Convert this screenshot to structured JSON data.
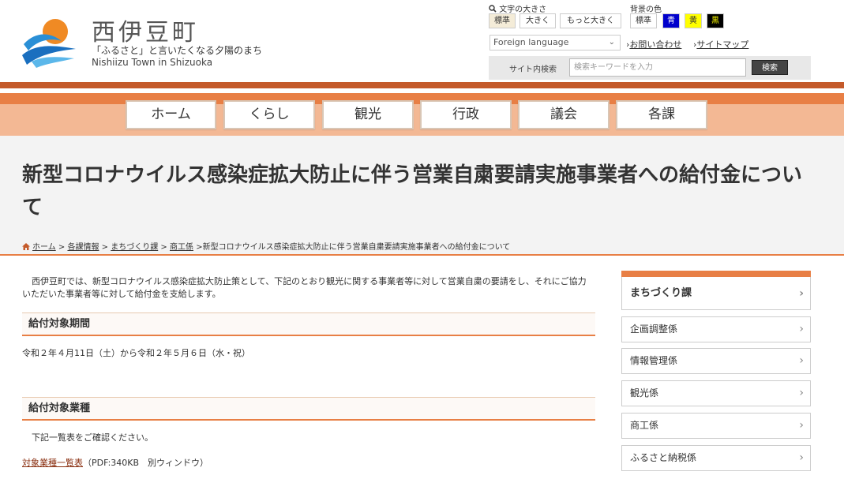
{
  "header": {
    "site_name": "西伊豆町",
    "tagline": "「ふるさと」と言いたくなる夕陽のまち",
    "tagline_en": "Nishiizu Town in Shizuoka"
  },
  "tools": {
    "font_size_label": "文字の大きさ",
    "font_sizes": [
      "標準",
      "大きく",
      "もっと大きく"
    ],
    "bg_color_label": "背景の色",
    "bg_colors": [
      {
        "label": "標準",
        "bg": "#ffffff",
        "fg": "#333333"
      },
      {
        "label": "青",
        "bg": "#0000cc",
        "fg": "#ffffff"
      },
      {
        "label": "黄",
        "bg": "#ffff00",
        "fg": "#333333"
      },
      {
        "label": "黒",
        "bg": "#000000",
        "fg": "#ffff00"
      }
    ],
    "language_select": "Foreign language",
    "contact_link": "お問い合わせ",
    "sitemap_link": "サイトマップ",
    "search_label": "サイト内検索",
    "search_placeholder": "検索キーワードを入力",
    "search_button": "検索"
  },
  "nav": [
    "ホーム",
    "くらし",
    "観光",
    "行政",
    "議会",
    "各課"
  ],
  "page": {
    "title": "新型コロナウイルス感染症拡大防止に伴う営業自粛要請実施事業者への給付金について",
    "breadcrumb": [
      "ホーム",
      "各課情報",
      "まちづくり課",
      "商工係"
    ],
    "breadcrumb_current": "新型コロナウイルス感染症拡大防止に伴う営業自粛要請実施事業者への給付金について",
    "intro": "西伊豆町では、新型コロナウイルス感染症拡大防止策として、下記のとおり観光に関する事業者等に対して営業自粛の要請をし、それにご協力いただいた事業者等に対して給付金を支給します。",
    "section1_heading": "給付対象期間",
    "section1_text": "令和２年４月11日（土）から令和２年５月６日（水・祝）",
    "section2_heading": "給付対象業種",
    "section2_text": "下記一覧表をご確認ください。",
    "doc_link": "対象業種一覧表",
    "doc_info": "（PDF:340KB　別ウィンドウ）"
  },
  "sidebar": {
    "header": "まちづくり課",
    "items": [
      "企画調整係",
      "情報管理係",
      "観光係",
      "商工係",
      "ふるさと納税係"
    ]
  },
  "colors": {
    "accent": "#e87f45",
    "dark_accent": "#c45a2a",
    "light_accent": "#f3b894"
  }
}
